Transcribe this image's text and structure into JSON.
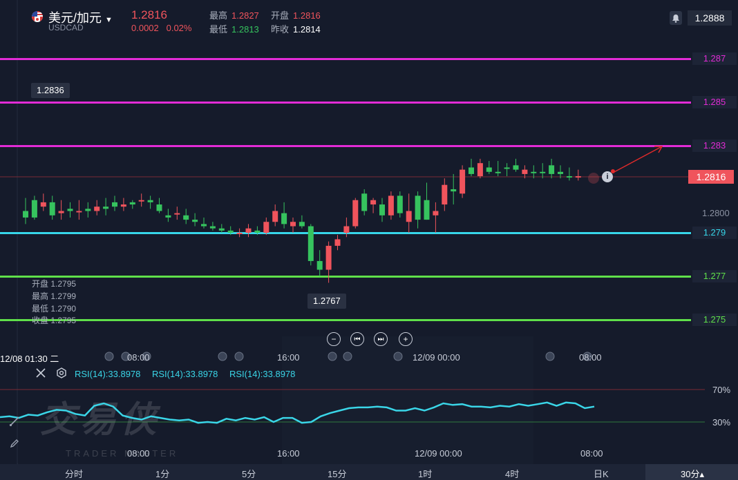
{
  "header": {
    "pair_name": "美元/加元",
    "symbol": "USDCAD",
    "price": "1.2816",
    "change": "0.0002",
    "change_pct": "0.02%",
    "high_label": "最高",
    "high": "1.2827",
    "open_label": "开盘",
    "open": "1.2816",
    "low_label": "最低",
    "low": "1.2813",
    "prev_close_label": "昨收",
    "prev_close": "1.2814",
    "top_right_price": "1.2888"
  },
  "levels": [
    {
      "label": "1.287",
      "color": "#e22bd6"
    },
    {
      "label": "1.285",
      "color": "#e22bd6"
    },
    {
      "label": "1.283",
      "color": "#e22bd6"
    },
    {
      "label": "1.279",
      "color": "#37d7ea"
    },
    {
      "label": "1.277",
      "color": "#5fe04a"
    },
    {
      "label": "1.275",
      "color": "#5fe04a"
    }
  ],
  "axis": {
    "current_price": "1.2816",
    "tick_2800": "1.2800"
  },
  "tooltips": {
    "high_marker": "1.2836",
    "low_marker": "1.2767"
  },
  "ohlc": {
    "open": "开盘 1.2795",
    "high": "最高 1.2799",
    "low": "最低 1.2790",
    "close": "收盘 1.2795"
  },
  "zoom_controls": {
    "zoom_out": "−",
    "back": "⏮",
    "forward": "⏭",
    "zoom_in": "+"
  },
  "time_axis": {
    "cursor_label": "12/08 01:30 二",
    "labels": [
      "08:00",
      "16:00",
      "12/09 00:00",
      "08:00"
    ]
  },
  "rsi": {
    "labels": [
      "RSI(14):33.8978",
      "RSI(14):33.8978",
      "RSI(14):33.8978"
    ],
    "level_70": "70%",
    "level_30": "30%"
  },
  "watermark": {
    "brand": "交易侠",
    "sub": "TRADER MASTER"
  },
  "timeframes": [
    "分时",
    "1分",
    "5分",
    "15分",
    "1时",
    "4时",
    "日K",
    "30分▴"
  ],
  "colors": {
    "up": "#36c35e",
    "down": "#f0545c",
    "bg": "#151b2b",
    "rsi_line": "#3ad6e8"
  },
  "chart_data": {
    "type": "candlestick",
    "candles": [
      {
        "o": 1.2797,
        "h": 1.2806,
        "l": 1.2794,
        "c": 1.28,
        "dir": "up"
      },
      {
        "o": 1.2797,
        "h": 1.2807,
        "l": 1.2796,
        "c": 1.2805,
        "dir": "up"
      },
      {
        "o": 1.2804,
        "h": 1.2808,
        "l": 1.28,
        "c": 1.2802,
        "dir": "down"
      },
      {
        "o": 1.2798,
        "h": 1.2807,
        "l": 1.2796,
        "c": 1.2804,
        "dir": "up"
      },
      {
        "o": 1.28,
        "h": 1.2805,
        "l": 1.2796,
        "c": 1.2799,
        "dir": "down"
      },
      {
        "o": 1.28,
        "h": 1.2804,
        "l": 1.2797,
        "c": 1.2801,
        "dir": "up"
      },
      {
        "o": 1.28,
        "h": 1.2805,
        "l": 1.2796,
        "c": 1.28,
        "dir": "down"
      },
      {
        "o": 1.28,
        "h": 1.2804,
        "l": 1.2797,
        "c": 1.2801,
        "dir": "up"
      },
      {
        "o": 1.2802,
        "h": 1.2805,
        "l": 1.2798,
        "c": 1.28,
        "dir": "down"
      },
      {
        "o": 1.2801,
        "h": 1.2806,
        "l": 1.2798,
        "c": 1.2802,
        "dir": "up"
      },
      {
        "o": 1.2802,
        "h": 1.2807,
        "l": 1.28,
        "c": 1.2804,
        "dir": "up"
      },
      {
        "o": 1.2803,
        "h": 1.2806,
        "l": 1.28,
        "c": 1.2802,
        "dir": "down"
      },
      {
        "o": 1.2803,
        "h": 1.2805,
        "l": 1.2801,
        "c": 1.2804,
        "dir": "up"
      },
      {
        "o": 1.2805,
        "h": 1.2808,
        "l": 1.2802,
        "c": 1.2805,
        "dir": "down"
      },
      {
        "o": 1.2804,
        "h": 1.2807,
        "l": 1.2801,
        "c": 1.2805,
        "dir": "up"
      },
      {
        "o": 1.2803,
        "h": 1.2806,
        "l": 1.2799,
        "c": 1.28,
        "dir": "up"
      },
      {
        "o": 1.2798,
        "h": 1.2801,
        "l": 1.2795,
        "c": 1.2797,
        "dir": "up"
      },
      {
        "o": 1.2799,
        "h": 1.2802,
        "l": 1.2796,
        "c": 1.2799,
        "dir": "down"
      },
      {
        "o": 1.2798,
        "h": 1.2801,
        "l": 1.2794,
        "c": 1.2796,
        "dir": "up"
      },
      {
        "o": 1.2796,
        "h": 1.2799,
        "l": 1.2793,
        "c": 1.2795,
        "dir": "up"
      },
      {
        "o": 1.2794,
        "h": 1.2797,
        "l": 1.2792,
        "c": 1.2793,
        "dir": "up"
      },
      {
        "o": 1.2793,
        "h": 1.2795,
        "l": 1.2791,
        "c": 1.2792,
        "dir": "up"
      },
      {
        "o": 1.2792,
        "h": 1.2794,
        "l": 1.279,
        "c": 1.2791,
        "dir": "up"
      },
      {
        "o": 1.2791,
        "h": 1.2793,
        "l": 1.2789,
        "c": 1.279,
        "dir": "up"
      },
      {
        "o": 1.279,
        "h": 1.2792,
        "l": 1.2788,
        "c": 1.279,
        "dir": "down"
      },
      {
        "o": 1.279,
        "h": 1.2794,
        "l": 1.2788,
        "c": 1.2792,
        "dir": "down"
      },
      {
        "o": 1.2791,
        "h": 1.2793,
        "l": 1.2789,
        "c": 1.279,
        "dir": "up"
      },
      {
        "o": 1.279,
        "h": 1.2797,
        "l": 1.2789,
        "c": 1.2795,
        "dir": "down"
      },
      {
        "o": 1.2795,
        "h": 1.2803,
        "l": 1.2793,
        "c": 1.28,
        "dir": "down"
      },
      {
        "o": 1.2799,
        "h": 1.2804,
        "l": 1.2792,
        "c": 1.2794,
        "dir": "up"
      },
      {
        "o": 1.2793,
        "h": 1.2797,
        "l": 1.279,
        "c": 1.2795,
        "dir": "down"
      },
      {
        "o": 1.2795,
        "h": 1.2798,
        "l": 1.2792,
        "c": 1.2793,
        "dir": "up"
      },
      {
        "o": 1.2793,
        "h": 1.2794,
        "l": 1.2775,
        "c": 1.2777,
        "dir": "up"
      },
      {
        "o": 1.2777,
        "h": 1.2782,
        "l": 1.277,
        "c": 1.2773,
        "dir": "up"
      },
      {
        "o": 1.2773,
        "h": 1.2786,
        "l": 1.2767,
        "c": 1.2784,
        "dir": "down"
      },
      {
        "o": 1.2784,
        "h": 1.2789,
        "l": 1.2782,
        "c": 1.2787,
        "dir": "down"
      },
      {
        "o": 1.279,
        "h": 1.2797,
        "l": 1.2788,
        "c": 1.2793,
        "dir": "down"
      },
      {
        "o": 1.2793,
        "h": 1.2806,
        "l": 1.2792,
        "c": 1.2805,
        "dir": "down"
      },
      {
        "o": 1.2808,
        "h": 1.281,
        "l": 1.2798,
        "c": 1.28,
        "dir": "up"
      },
      {
        "o": 1.2803,
        "h": 1.2806,
        "l": 1.2799,
        "c": 1.2805,
        "dir": "down"
      },
      {
        "o": 1.2803,
        "h": 1.2806,
        "l": 1.2795,
        "c": 1.2798,
        "dir": "up"
      },
      {
        "o": 1.2798,
        "h": 1.2809,
        "l": 1.2796,
        "c": 1.2807,
        "dir": "down"
      },
      {
        "o": 1.2807,
        "h": 1.2809,
        "l": 1.2797,
        "c": 1.2799,
        "dir": "up"
      },
      {
        "o": 1.2795,
        "h": 1.2808,
        "l": 1.279,
        "c": 1.28,
        "dir": "down"
      },
      {
        "o": 1.2807,
        "h": 1.2809,
        "l": 1.2792,
        "c": 1.2796,
        "dir": "up"
      },
      {
        "o": 1.2805,
        "h": 1.2813,
        "l": 1.2796,
        "c": 1.2796,
        "dir": "up"
      },
      {
        "o": 1.2798,
        "h": 1.2804,
        "l": 1.279,
        "c": 1.28,
        "dir": "down"
      },
      {
        "o": 1.2803,
        "h": 1.2815,
        "l": 1.28,
        "c": 1.2812,
        "dir": "down"
      },
      {
        "o": 1.2809,
        "h": 1.2817,
        "l": 1.2803,
        "c": 1.281,
        "dir": "up"
      },
      {
        "o": 1.2808,
        "h": 1.2821,
        "l": 1.2806,
        "c": 1.2819,
        "dir": "down"
      },
      {
        "o": 1.282,
        "h": 1.2824,
        "l": 1.2816,
        "c": 1.2817,
        "dir": "up"
      },
      {
        "o": 1.2816,
        "h": 1.2824,
        "l": 1.2815,
        "c": 1.2822,
        "dir": "down"
      },
      {
        "o": 1.282,
        "h": 1.2823,
        "l": 1.2817,
        "c": 1.2818,
        "dir": "up"
      },
      {
        "o": 1.2818,
        "h": 1.2823,
        "l": 1.2816,
        "c": 1.2818,
        "dir": "up"
      },
      {
        "o": 1.282,
        "h": 1.2822,
        "l": 1.2816,
        "c": 1.282,
        "dir": "up"
      },
      {
        "o": 1.2821,
        "h": 1.2824,
        "l": 1.2818,
        "c": 1.2819,
        "dir": "up"
      },
      {
        "o": 1.2817,
        "h": 1.2821,
        "l": 1.2815,
        "c": 1.2819,
        "dir": "down"
      },
      {
        "o": 1.2818,
        "h": 1.2821,
        "l": 1.2815,
        "c": 1.2818,
        "dir": "up"
      },
      {
        "o": 1.2818,
        "h": 1.2822,
        "l": 1.2815,
        "c": 1.2818,
        "dir": "up"
      },
      {
        "o": 1.2821,
        "h": 1.2824,
        "l": 1.2815,
        "c": 1.2817,
        "dir": "up"
      },
      {
        "o": 1.2818,
        "h": 1.2821,
        "l": 1.2815,
        "c": 1.2817,
        "dir": "up"
      },
      {
        "o": 1.2816,
        "h": 1.282,
        "l": 1.2814,
        "c": 1.2816,
        "dir": "up"
      },
      {
        "o": 1.2816,
        "h": 1.2819,
        "l": 1.2814,
        "c": 1.2816,
        "dir": "down"
      }
    ],
    "rsi": [
      36,
      37,
      35,
      39,
      38,
      42,
      45,
      44,
      40,
      38,
      50,
      53,
      49,
      38,
      35,
      33,
      37,
      35,
      33,
      32,
      33,
      29,
      30,
      29,
      34,
      32,
      35,
      33,
      36,
      30,
      35,
      35,
      29,
      30,
      37,
      41,
      44,
      47,
      48,
      48,
      49,
      48,
      44,
      44,
      47,
      44,
      48,
      53,
      51,
      52,
      49,
      49,
      48,
      50,
      49,
      52,
      50,
      52,
      54,
      50,
      54,
      53,
      47,
      49
    ],
    "price_axis_ticks": [
      "1.287",
      "1.285",
      "1.283",
      "1.2816",
      "1.2800",
      "1.279",
      "1.277",
      "1.275"
    ],
    "ylim": [
      1.2745,
      1.2872
    ]
  }
}
